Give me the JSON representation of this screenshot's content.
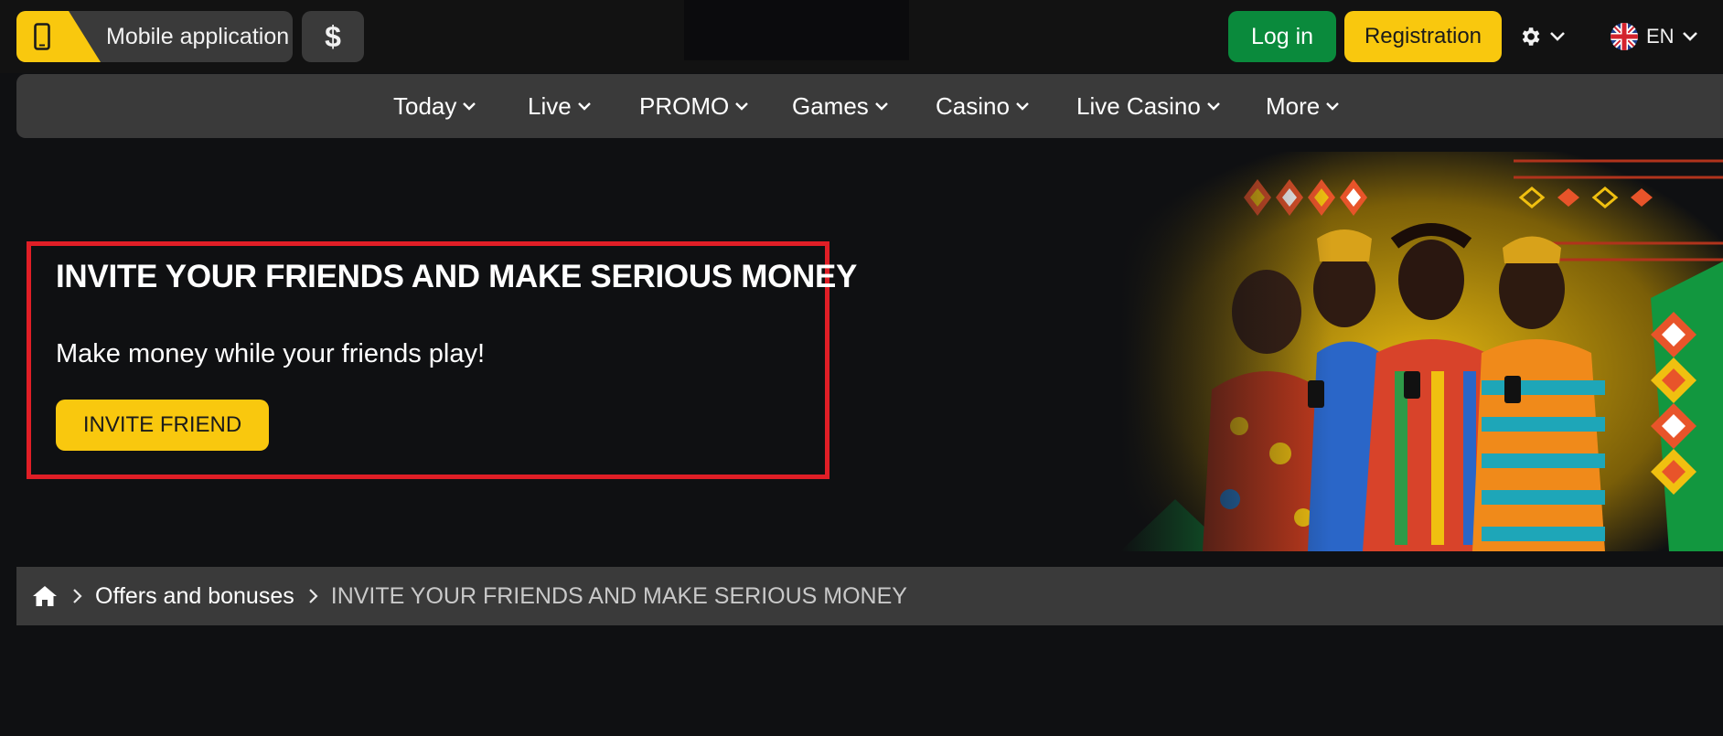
{
  "header": {
    "mobile_app_label": "Mobile application",
    "currency_symbol": "$",
    "login_label": "Log in",
    "registration_label": "Registration",
    "language_code": "EN"
  },
  "nav": {
    "items": [
      {
        "label": "Today"
      },
      {
        "label": "Live"
      },
      {
        "label": "PROMO"
      },
      {
        "label": "Games"
      },
      {
        "label": "Casino"
      },
      {
        "label": "Live Casino"
      },
      {
        "label": "More"
      }
    ]
  },
  "promo": {
    "title": "INVITE YOUR FRIENDS AND MAKE SERIOUS MONEY",
    "subtitle": "Make money while your friends play!",
    "button_label": "INVITE FRIEND"
  },
  "breadcrumb": {
    "link": "Offers and bonuses",
    "current": "INVITE YOUR FRIENDS AND MAKE SERIOUS MONEY"
  },
  "colors": {
    "accent_yellow": "#f9c80e",
    "login_green": "#0a8a3c",
    "highlight_red": "#e01e26",
    "panel_gray": "#3a3a3a",
    "background": "#0f1012"
  },
  "icons": {
    "mobile": "phone-icon",
    "settings": "gear-icon",
    "language": "uk-flag-icon",
    "dropdown": "chevron-down-icon",
    "home": "home-icon",
    "separator": "chevron-right-icon"
  }
}
